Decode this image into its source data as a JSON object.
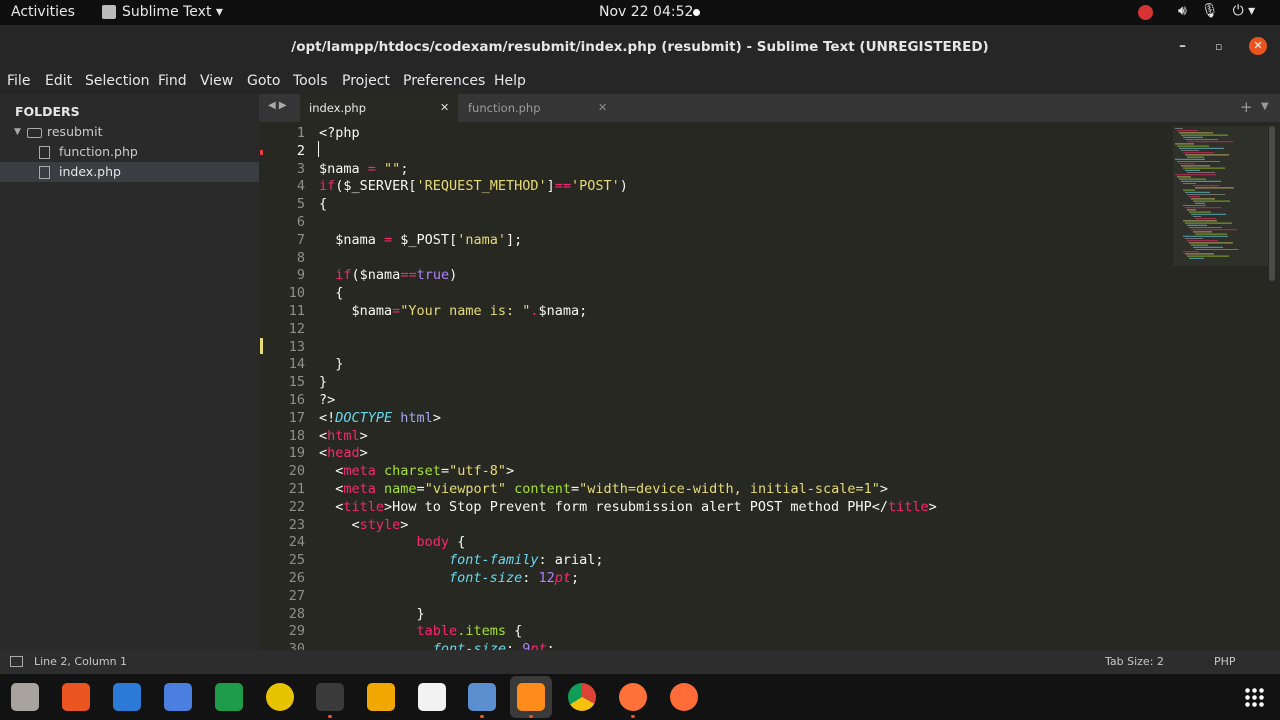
{
  "topbar": {
    "activities": "Activities",
    "app_menu": "Sublime Text ▾",
    "clock": "Nov 22  04:52"
  },
  "window": {
    "title": "/opt/lampp/htdocs/codexam/resubmit/index.php (resubmit) - Sublime Text (UNREGISTERED)"
  },
  "menu": [
    "File",
    "Edit",
    "Selection",
    "Find",
    "View",
    "Goto",
    "Tools",
    "Project",
    "Preferences",
    "Help"
  ],
  "sidebar": {
    "header": "FOLDERS",
    "folder": "resubmit",
    "files": [
      "function.php",
      "index.php"
    ],
    "selected": "index.php"
  },
  "tabs": [
    {
      "label": "index.php",
      "active": true
    },
    {
      "label": "function.php",
      "active": false
    }
  ],
  "editor": {
    "current_line": 2,
    "lines": [
      [
        [
          "<?php",
          "#f8f8f2"
        ]
      ],
      [],
      [
        [
          "$nama ",
          "#f8f8f2"
        ],
        [
          "= ",
          "#f92672"
        ],
        [
          "\"\"",
          "#e6db74"
        ],
        [
          ";",
          "#f8f8f2"
        ]
      ],
      [
        [
          "if",
          "#f92672"
        ],
        [
          "($_SERVER[",
          "#f8f8f2"
        ],
        [
          "'REQUEST_METHOD'",
          "#e6db74"
        ],
        [
          "]",
          "#f8f8f2"
        ],
        [
          "==",
          "#f92672"
        ],
        [
          "'POST'",
          "#e6db74"
        ],
        [
          ")",
          "#f8f8f2"
        ]
      ],
      [
        [
          "{",
          "#f8f8f2"
        ]
      ],
      [],
      [
        [
          "  $nama ",
          "#f8f8f2"
        ],
        [
          "= ",
          "#f92672"
        ],
        [
          "$_POST[",
          "#f8f8f2"
        ],
        [
          "'nama'",
          "#e6db74"
        ],
        [
          "];",
          "#f8f8f2"
        ]
      ],
      [],
      [
        [
          "  ",
          "#f8f8f2"
        ],
        [
          "if",
          "#f92672"
        ],
        [
          "($nama",
          "#f8f8f2"
        ],
        [
          "==",
          "#f92672"
        ],
        [
          "true",
          "#ae81ff"
        ],
        [
          ")",
          "#f8f8f2"
        ]
      ],
      [
        [
          "  {",
          "#f8f8f2"
        ]
      ],
      [
        [
          "    $nama",
          "#f8f8f2"
        ],
        [
          "=",
          "#f92672"
        ],
        [
          "\"Your name is: \"",
          "#e6db74"
        ],
        [
          ".",
          "#f92672"
        ],
        [
          "$nama;",
          "#f8f8f2"
        ]
      ],
      [],
      [],
      [
        [
          "  }",
          "#f8f8f2"
        ]
      ],
      [
        [
          "}",
          "#f8f8f2"
        ]
      ],
      [
        [
          "?>",
          "#f8f8f2"
        ]
      ],
      [
        [
          "<!",
          "#f8f8f2"
        ],
        [
          "DOCTYPE",
          "#66d9ef",
          "i"
        ],
        [
          " html",
          "#a6a6f2"
        ],
        [
          ">",
          "#f8f8f2"
        ]
      ],
      [
        [
          "<",
          "#f8f8f2"
        ],
        [
          "html",
          "#f92672"
        ],
        [
          ">",
          "#f8f8f2"
        ]
      ],
      [
        [
          "<",
          "#f8f8f2"
        ],
        [
          "head",
          "#f92672"
        ],
        [
          ">",
          "#f8f8f2"
        ]
      ],
      [
        [
          "  <",
          "#f8f8f2"
        ],
        [
          "meta",
          "#f92672"
        ],
        [
          " charset",
          "#a6e22e"
        ],
        [
          "=",
          "#f8f8f2"
        ],
        [
          "\"utf-8\"",
          "#e6db74"
        ],
        [
          ">",
          "#f8f8f2"
        ]
      ],
      [
        [
          "  <",
          "#f8f8f2"
        ],
        [
          "meta",
          "#f92672"
        ],
        [
          " name",
          "#a6e22e"
        ],
        [
          "=",
          "#f8f8f2"
        ],
        [
          "\"viewport\"",
          "#e6db74"
        ],
        [
          " content",
          "#a6e22e"
        ],
        [
          "=",
          "#f8f8f2"
        ],
        [
          "\"width=device-width, initial-scale=1\"",
          "#e6db74"
        ],
        [
          ">",
          "#f8f8f2"
        ]
      ],
      [
        [
          "  <",
          "#f8f8f2"
        ],
        [
          "title",
          "#f92672"
        ],
        [
          ">How to Stop Prevent form resubmission alert POST method PHP</",
          "#f8f8f2"
        ],
        [
          "title",
          "#f92672"
        ],
        [
          ">",
          "#f8f8f2"
        ]
      ],
      [
        [
          "    <",
          "#f8f8f2"
        ],
        [
          "style",
          "#f92672"
        ],
        [
          ">",
          "#f8f8f2"
        ]
      ],
      [
        [
          "            ",
          "#f8f8f2"
        ],
        [
          "body",
          "#f92672"
        ],
        [
          " {",
          "#f8f8f2"
        ]
      ],
      [
        [
          "                ",
          "#f8f8f2"
        ],
        [
          "font-family",
          "#66d9ef",
          "i"
        ],
        [
          ": arial;",
          "#f8f8f2"
        ]
      ],
      [
        [
          "                ",
          "#f8f8f2"
        ],
        [
          "font-size",
          "#66d9ef",
          "i"
        ],
        [
          ": ",
          "#f8f8f2"
        ],
        [
          "12",
          "#ae81ff"
        ],
        [
          "pt",
          "#f92672",
          "i"
        ],
        [
          ";",
          "#f8f8f2"
        ]
      ],
      [],
      [
        [
          "            }",
          "#f8f8f2"
        ]
      ],
      [
        [
          "            ",
          "#f8f8f2"
        ],
        [
          "table",
          "#f92672"
        ],
        [
          ".items",
          "#a6e22e"
        ],
        [
          " {",
          "#f8f8f2"
        ]
      ],
      [
        [
          "              ",
          "#f8f8f2"
        ],
        [
          "font-size",
          "#66d9ef",
          "i"
        ],
        [
          ": ",
          "#f8f8f2"
        ],
        [
          "9",
          "#ae81ff"
        ],
        [
          "pt",
          "#f92672",
          "i"
        ],
        [
          ";",
          "#f8f8f2"
        ]
      ]
    ]
  },
  "status": {
    "position": "Line 2, Column 1",
    "tab_size": "Tab Size: 2",
    "syntax": "PHP"
  },
  "dock_icons": [
    "files-icon",
    "software-icon",
    "writer-doc-icon",
    "screenshot-icon",
    "calc-icon",
    "rhythmbox-icon",
    "terminal-icon",
    "calculator-icon",
    "text-editor-icon",
    "app-icon",
    "sublime-text-icon",
    "chrome-icon",
    "firefox-icon",
    "postman-icon",
    "show-apps-icon"
  ]
}
